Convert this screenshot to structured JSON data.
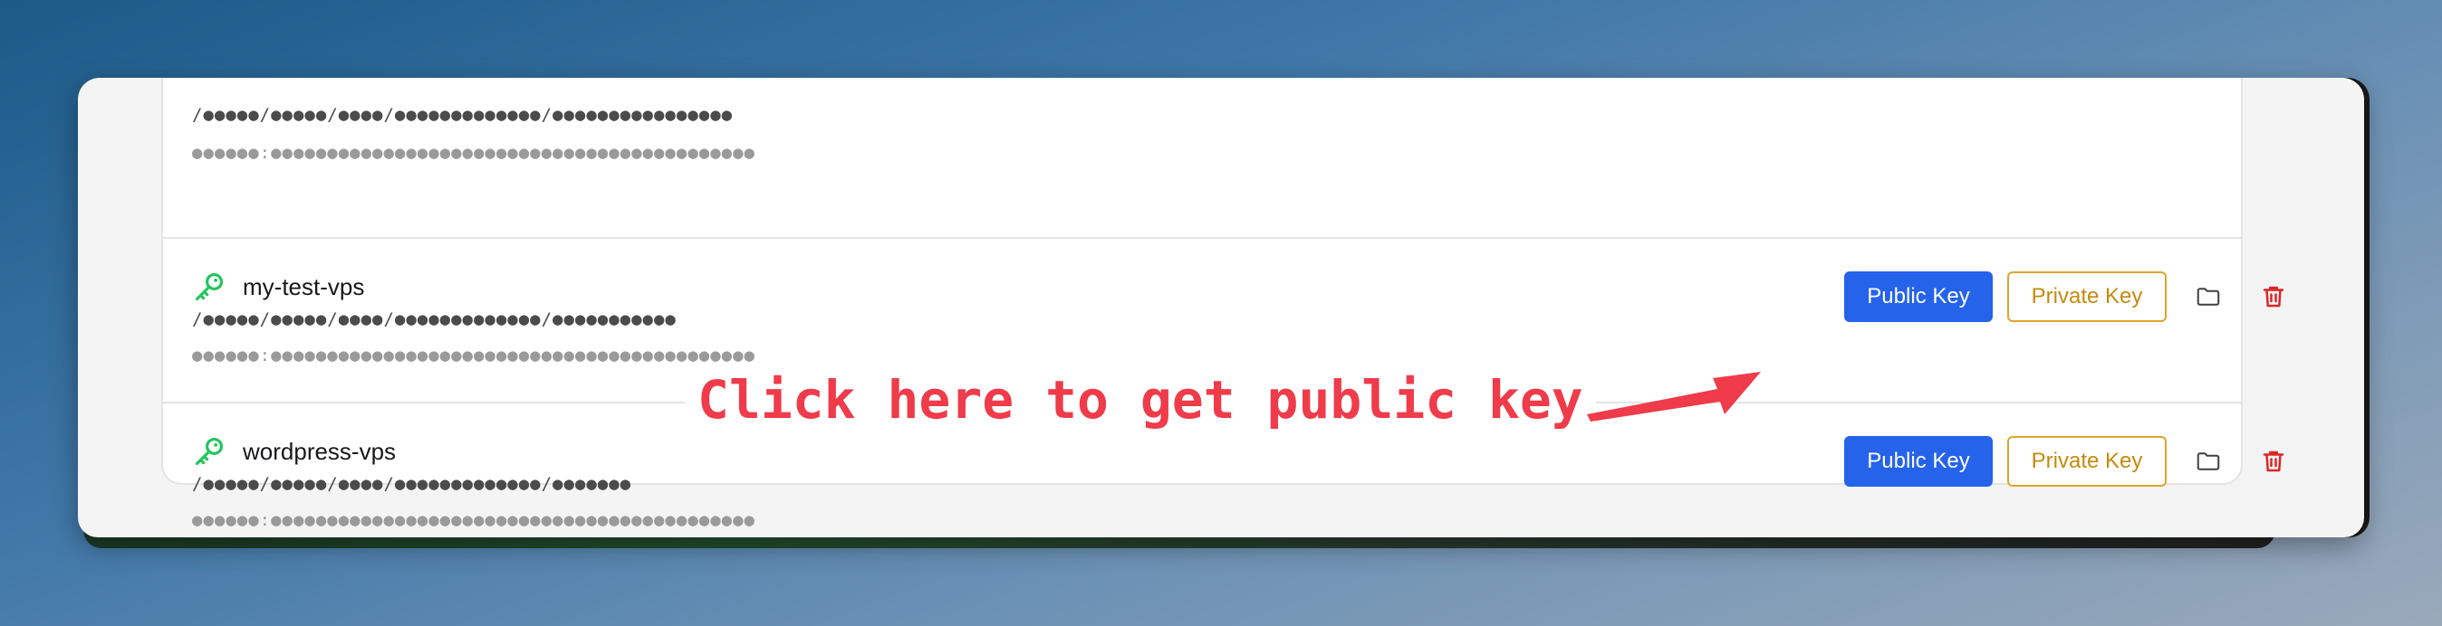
{
  "keys": [
    {
      "name": "",
      "path_masked": "/●●●●●/●●●●●/●●●●/●●●●●●●●●●●●●/●●●●●●●●●●●●●●●●",
      "fingerprint_masked": "●●●●●●:●●●●●●●●●●●●●●●●●●●●●●●●●●●●●●●●●●●●●●●●●●●"
    },
    {
      "name": "my-test-vps",
      "path_masked": "/●●●●●/●●●●●/●●●●/●●●●●●●●●●●●●/●●●●●●●●●●●",
      "fingerprint_masked": "●●●●●●:●●●●●●●●●●●●●●●●●●●●●●●●●●●●●●●●●●●●●●●●●●●",
      "public_key_label": "Public Key",
      "private_key_label": "Private Key"
    },
    {
      "name": "wordpress-vps",
      "path_masked": "/●●●●●/●●●●●/●●●●/●●●●●●●●●●●●●/●●●●●●●",
      "fingerprint_masked": "●●●●●●:●●●●●●●●●●●●●●●●●●●●●●●●●●●●●●●●●●●●●●●●●●●",
      "public_key_label": "Public Key",
      "private_key_label": "Private Key"
    }
  ],
  "icons": {
    "key": "key-icon",
    "folder": "folder-icon",
    "trash": "trash-icon"
  },
  "colors": {
    "key_icon": "#22c55e",
    "public_key_button": "#2563eb",
    "private_key_button": "#e0a42b",
    "trash_icon": "#dc2626",
    "annotation": "#ef3b4a"
  },
  "annotation": {
    "text": "Click here to get public key"
  }
}
